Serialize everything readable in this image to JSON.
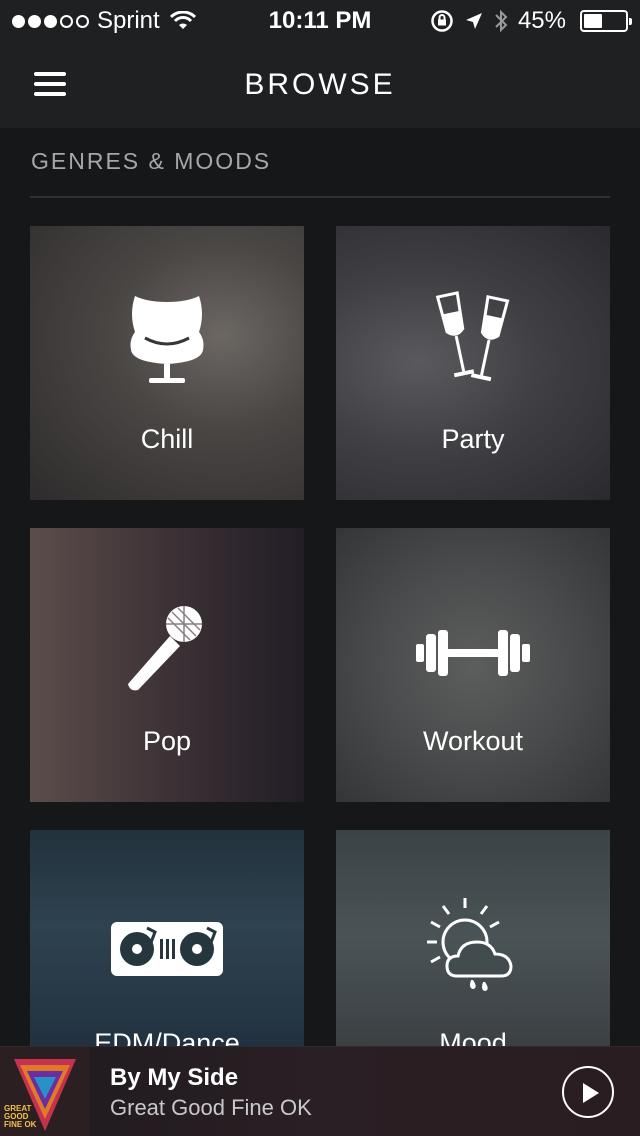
{
  "status_bar": {
    "carrier": "Sprint",
    "time": "10:11 PM",
    "battery_percent": "45%",
    "battery_level": 0.45,
    "signal_bars_filled": 3,
    "signal_bars_total": 5
  },
  "nav": {
    "title": "BROWSE",
    "menu_icon": "hamburger-menu-icon"
  },
  "section": {
    "title": "GENRES & MOODS"
  },
  "tiles": [
    {
      "label": "Chill",
      "icon": "egg-chair-icon"
    },
    {
      "label": "Party",
      "icon": "champagne-glasses-icon"
    },
    {
      "label": "Pop",
      "icon": "microphone-icon"
    },
    {
      "label": "Workout",
      "icon": "dumbbell-icon"
    },
    {
      "label": "EDM/Dance",
      "icon": "turntables-icon"
    },
    {
      "label": "Mood",
      "icon": "sun-cloud-rain-icon"
    }
  ],
  "player": {
    "track_title": "By My Side",
    "artist": "Great Good Fine OK",
    "album_art_text": "GREAT GOOD FINE OK",
    "play_icon": "play-icon"
  },
  "colors": {
    "background": "#161719",
    "header": "#1f2022",
    "section_text": "#a5a7aa",
    "divider": "#2e3033"
  }
}
